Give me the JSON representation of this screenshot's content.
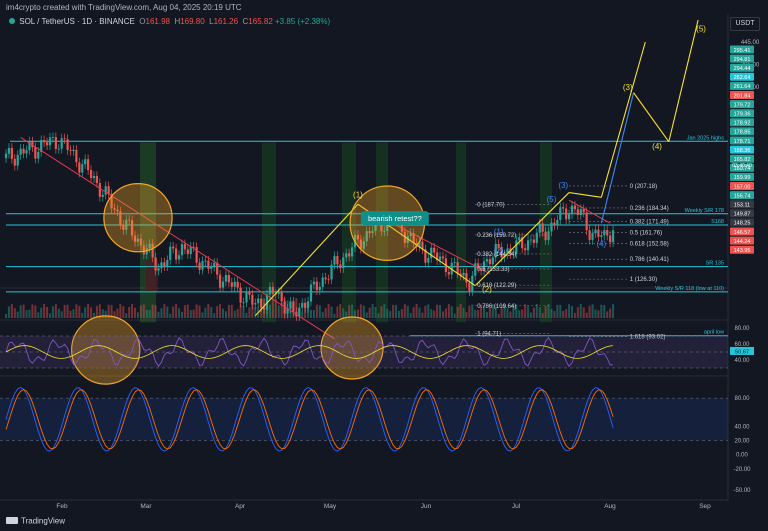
{
  "header": {
    "credit": "im4crypto created with TradingView.com, Aug 04, 2025 20:19 UTC",
    "symbol": "SOL / TetherUS · 1D · BINANCE",
    "ohlc": {
      "o": "161.98",
      "h": "169.80",
      "l": "161.26",
      "c": "165.82",
      "change": "+3.85 (+2.38%)"
    },
    "currency": "USDT"
  },
  "footer": {
    "brand": "TradingView"
  },
  "colors": {
    "background": "#131722",
    "up": "#26a69a",
    "down": "#ef5350",
    "cyan": "#26c6da",
    "yellow": "#f5e12a",
    "orange": "#f5a623",
    "red_line": "#e53950",
    "blue": "#4285f4"
  },
  "chart_data": [
    {
      "type": "candlestick",
      "title": "SOL / TetherUS · 1D · BINANCE",
      "x_ticks": [
        "Feb",
        "Mar",
        "Apr",
        "May",
        "Jun",
        "Jul",
        "Aug",
        "Sep"
      ],
      "y_ticks": [
        445.0,
        395.0,
        350.0,
        40.0
      ],
      "price_badges": [
        {
          "value": "295.41",
          "color": "#26a69a"
        },
        {
          "value": "294.81",
          "color": "#26a69a"
        },
        {
          "value": "294.44",
          "color": "#26a69a"
        },
        {
          "value": "262.64",
          "color": "#26c6da"
        },
        {
          "value": "261.64",
          "color": "#26a69a"
        },
        {
          "value": "201.84",
          "color": "#ef5350"
        },
        {
          "value": "179.72",
          "color": "#26a69a"
        },
        {
          "value": "179.36",
          "color": "#26a69a"
        },
        {
          "value": "178.92",
          "color": "#26a69a"
        },
        {
          "value": "178.85",
          "color": "#26a69a"
        },
        {
          "value": "178.71",
          "color": "#26a69a"
        },
        {
          "value": "168.36",
          "color": "#26c6da"
        },
        {
          "value": "165.82",
          "color": "#26a69a"
        },
        {
          "value": "160.74",
          "color": "#26a69a"
        },
        {
          "value": "159.99",
          "color": "#26a69a"
        },
        {
          "value": "157.00",
          "color": "#ef5350"
        },
        {
          "value": "156.74",
          "color": "#26a69a"
        },
        {
          "value": "153.11",
          "color": "#363a45"
        },
        {
          "value": "149.87",
          "color": "#363a45"
        },
        {
          "value": "148.25",
          "color": "#363a45"
        },
        {
          "value": "146.57",
          "color": "#ef5350"
        },
        {
          "value": "144.24",
          "color": "#ef5350"
        },
        {
          "value": "143.95",
          "color": "#ef5350"
        }
      ],
      "countdown": "03:40:40",
      "hlines": [
        {
          "label": "Jan 2025 highs",
          "color": "#26c6da"
        },
        {
          "label": "Weekly S/R 178",
          "color": "#26c6da"
        },
        {
          "label": "S168",
          "color": "#26c6da"
        },
        {
          "label": "SR 135",
          "color": "#26c6da"
        },
        {
          "label": "Weekly S/R 118 (low at 110)",
          "color": "#26c6da"
        },
        {
          "label": "april low",
          "color": "#26c6da"
        }
      ],
      "fib_right": [
        {
          "ratio": "0",
          "price": 207.18
        },
        {
          "ratio": "0.236",
          "price": 184.34
        },
        {
          "ratio": "0.382",
          "price": 171.49
        },
        {
          "ratio": "0.5",
          "price": 161.76
        },
        {
          "ratio": "0.618",
          "price": 152.58
        },
        {
          "ratio": "0.786",
          "price": 140.41
        },
        {
          "ratio": "1",
          "price": 126.3
        },
        {
          "ratio": "1.618",
          "price": 93.02
        }
      ],
      "fib_left": [
        {
          "ratio": "0",
          "price": 187.7
        },
        {
          "ratio": "0.236",
          "price": 159.72
        },
        {
          "ratio": "0.382",
          "price": 144.34
        },
        {
          "ratio": "0.5",
          "price": 133.33
        },
        {
          "ratio": "0.618",
          "price": 122.29
        },
        {
          "ratio": "0.786",
          "price": 109.64
        },
        {
          "ratio": "1",
          "price": 94.71
        }
      ],
      "fib_text": {
        "right": [
          "0 (207.18)",
          "0.236 (184.34)",
          "0.382 (171.49)",
          "0.5 (161.76)",
          "0.618 (152.58)",
          "0.786 (140.41)",
          "1 (126.30)",
          "1.618 (93.02)"
        ],
        "left": [
          "0 (187.70)",
          "0.236 (159.72)",
          "0.382 (144.34)",
          "0.5 (133.33)",
          "0.618 (122.29)",
          "0.786 (109.64)",
          "1 (94.71)"
        ]
      },
      "wave_labels": [
        "(1)",
        "(2)",
        "(3)",
        "(4)",
        "(5)",
        "(1)",
        "(2)",
        "(3)",
        "(4)",
        "(5)"
      ],
      "annotation": "bearish retest??",
      "trend": "uptrend from April low, corrective dip, projected wave (3)-(5) rally above 445"
    },
    {
      "type": "line",
      "title": "RSI",
      "y_ticks": [
        80.0,
        60.0,
        40.0
      ],
      "current_value": "50.67"
    },
    {
      "type": "line",
      "title": "Stochastic RSI",
      "y_ticks": [
        80.0,
        40.0,
        20.0,
        0.0,
        -20.0,
        -50.0
      ],
      "y_labels": [
        "80.00",
        "40.00",
        "20.00",
        "0.00",
        "-20.00",
        "-50.00"
      ],
      "current_values": [
        "0.00",
        "4.00"
      ]
    }
  ]
}
